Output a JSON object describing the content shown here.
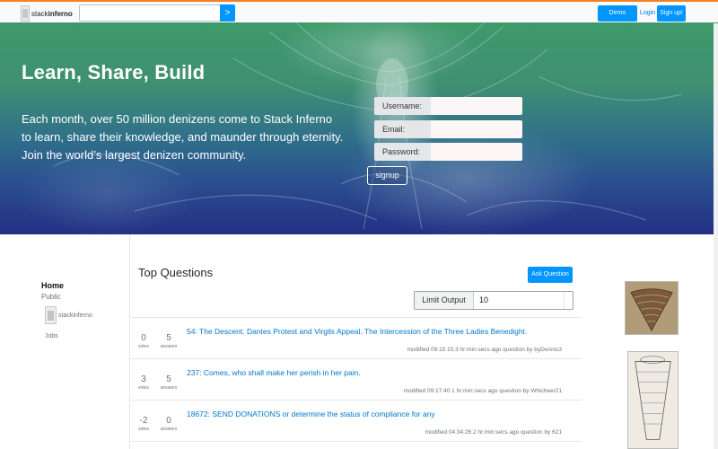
{
  "header": {
    "logo_prefix": "stack",
    "logo_suffix": "inferno",
    "search_placeholder": "",
    "search_button": ">",
    "demo_login": "Demo Login",
    "login": "Login",
    "signup": "Sign up!",
    "accent": "#f48024",
    "button_color": "#0095ff"
  },
  "hero": {
    "title": "Learn, Share, Build",
    "text": "Each month, over 50 million denizens come to Stack Inferno to learn, share their knowledge, and maunder through eternity. Join the world’s largest denizen community.",
    "username_label": "Username:",
    "email_label": "Email:",
    "password_label": "Password:",
    "signup_button": "signup"
  },
  "sidebar": {
    "home": "Home",
    "public": "Public",
    "site": "stackinferno",
    "jobs": "Jobs"
  },
  "main": {
    "title": "Top Questions",
    "ask_button": "Ask Question",
    "limit_label": "Limit Output",
    "limit_value": "10",
    "votes_label": "votes",
    "answers_label": "answers",
    "questions": [
      {
        "votes": "0",
        "answers": "5",
        "title": "54: The Descent. Dantes Protest and Virgils Appeal. The Intercession of the Three Ladies Benedight.",
        "meta": "modified 09:15:15.3 hr:min:secs ago    question by byDennis3"
      },
      {
        "votes": "3",
        "answers": "5",
        "title": "237: Comes, who shall make her perish in her pain.",
        "meta": "modified 09:17:40.1 hr:min:secs ago    question by Whicheer21"
      },
      {
        "votes": "-2",
        "answers": "0",
        "title": "18672: SEND DONATIONS or determine the status of compliance for any",
        "meta": "modified 04:34:26.2 hr:min:secs ago    question by 621"
      }
    ]
  }
}
